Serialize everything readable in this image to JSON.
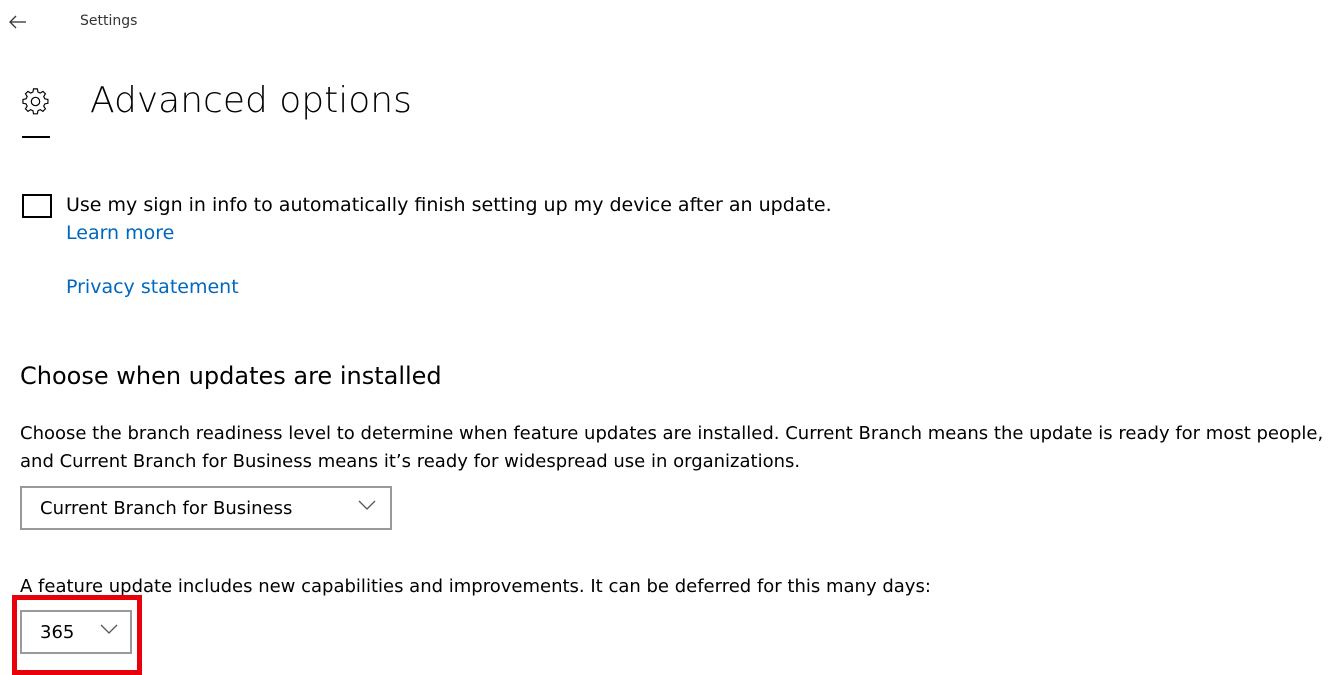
{
  "window": {
    "app_title": "Settings",
    "back_icon": "arrow-left-icon"
  },
  "header": {
    "icon": "gear-icon",
    "title": "Advanced options"
  },
  "signin": {
    "checked": false,
    "label": "Use my sign in info to automatically finish setting up my device after an update.",
    "learn_more": "Learn more",
    "privacy": "Privacy statement"
  },
  "updates": {
    "section_title": "Choose when updates are installed",
    "description": "Choose the branch readiness level to determine when feature updates are installed. Current Branch means the update is ready for most people, and Current Branch for Business means it’s ready for widespread use in organizations.",
    "branch_selected": "Current Branch for Business",
    "feature_text": "A feature update includes new capabilities and improvements. It can be deferred for this many days:",
    "deferral_days": "365"
  },
  "colors": {
    "link": "#0067c0",
    "highlight": "#e8000b",
    "dropdown_border": "#999999"
  }
}
